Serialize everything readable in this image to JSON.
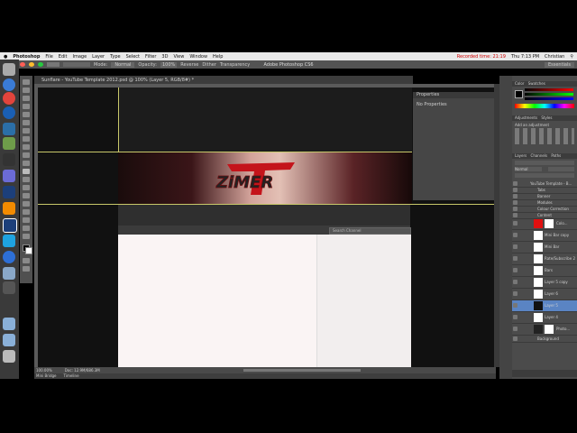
{
  "menubar": {
    "app": "Photoshop",
    "items": [
      "File",
      "Edit",
      "Image",
      "Layer",
      "Type",
      "Select",
      "Filter",
      "3D",
      "View",
      "Window",
      "Help"
    ],
    "recording": "Recorded time: 21:19",
    "clock": "Thu 7:13 PM",
    "user": "Christian"
  },
  "window": {
    "title": "Adobe Photoshop CS6"
  },
  "options": {
    "mode_label": "Mode:",
    "mode_value": "Normal",
    "opacity_label": "Opacity:",
    "opacity_value": "100%",
    "reverse": "Reverse",
    "dither": "Dither",
    "transparency": "Transparency"
  },
  "document": {
    "tab": "Sunflare - YouTube Template 2012.psd @ 100% (Layer 5, RGB/8#) *",
    "zoom": "100.00%",
    "doc_size": "Doc: 12.9M/686.3M"
  },
  "canvas": {
    "logo_text": "ZiMER",
    "search_placeholder": "Search Channel"
  },
  "properties": {
    "title": "Properties",
    "sub": "No Properties"
  },
  "minibridge": {
    "tab1": "Mini Bridge",
    "tab2": "Timeline"
  },
  "right_panel": {
    "workspace": "Essentials",
    "color_tab": "Color",
    "swatches_tab": "Swatches",
    "adjustments_tab": "Adjustments",
    "styles_tab": "Styles",
    "add_adjustment": "Add an adjustment",
    "layers_tab": "Layers",
    "channels_tab": "Channels",
    "paths_tab": "Paths",
    "blend_mode": "Normal",
    "group_name": "YouTube Template - B...",
    "groups": [
      "Tabs",
      "Banner",
      "Modules",
      "Colour Correction",
      "Content"
    ],
    "layers": [
      "Colo...",
      "Mini Bar copy",
      "Mini Bar",
      "Rate/Subscribe 2",
      "Bars",
      "Layer 5 copy",
      "Layer 6",
      "Layer 5",
      "Layer 4",
      "Photo...",
      "Background"
    ]
  },
  "colors": {
    "accent": "#d00000",
    "selected_layer": "#5a84c3",
    "guide": "#c8c86a"
  }
}
